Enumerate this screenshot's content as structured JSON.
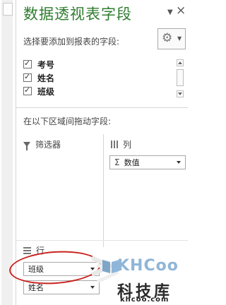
{
  "pane": {
    "title": "数据透视表字段",
    "choose_label": "选择要添加到报表的字段:",
    "drag_hint": "在以下区域间拖动字段:"
  },
  "fields": [
    {
      "label": "考号",
      "checked": true
    },
    {
      "label": "姓名",
      "checked": true
    },
    {
      "label": "班级",
      "checked": true
    }
  ],
  "areas": {
    "filter": {
      "label": "筛选器",
      "icon": "filter-icon"
    },
    "columns": {
      "label": "列",
      "icon": "columns-icon",
      "chips": [
        {
          "label": "数值"
        }
      ]
    },
    "rows": {
      "label": "行",
      "icon": "rows-icon",
      "chips": [
        {
          "label": "班级"
        },
        {
          "label": "姓名"
        }
      ]
    }
  },
  "icons": {
    "gear": "⚙",
    "close": "×",
    "dropdown": "▼",
    "sigma": "Σ"
  },
  "watermark": {
    "brand": "KHCoo",
    "cn": "科技库",
    "url": "khcoo.com"
  },
  "colors": {
    "title": "#2f7d2f",
    "highlight_ellipse": "#c8231f"
  }
}
